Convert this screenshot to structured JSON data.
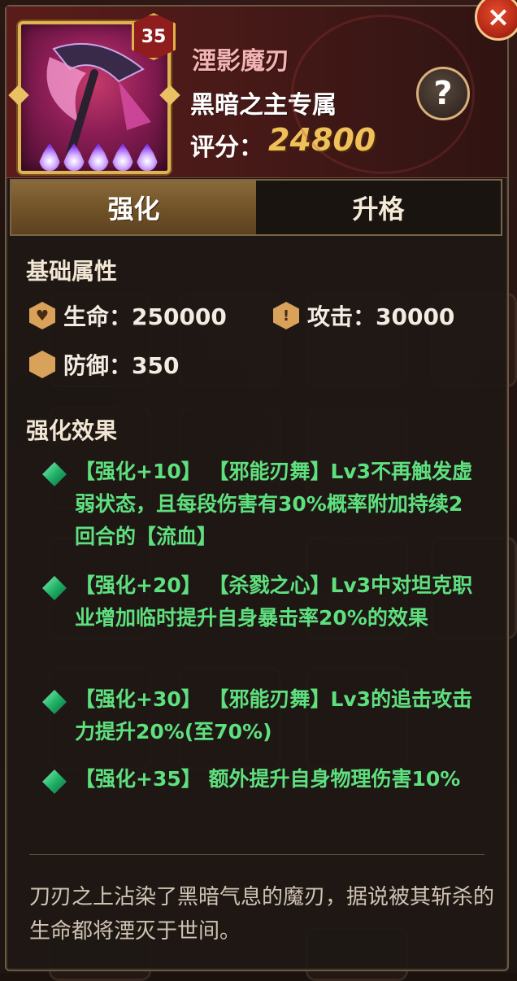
{
  "item": {
    "level": "35",
    "name": "湮影魔刃",
    "subtitle": "黑暗之主专属",
    "score_label": "评分：",
    "score_value": "24800",
    "star_flames": 5
  },
  "buttons": {
    "help": "?",
    "close": "×"
  },
  "tabs": [
    {
      "label": "强化",
      "active": true
    },
    {
      "label": "升格",
      "active": false
    }
  ],
  "base_attrs": {
    "title": "基础属性",
    "stats": [
      {
        "icon": "heart-icon",
        "label": "生命：250000"
      },
      {
        "icon": "sword-icon",
        "label": "攻击：30000"
      },
      {
        "icon": "shield-icon",
        "label": "防御：350"
      }
    ]
  },
  "effects": {
    "title": "强化效果",
    "items": [
      {
        "text": "【强化+10】  【邪能刃舞】Lv3不再触发虚弱状态，且每段伤害有30%概率附加持续2回合的【流血】"
      },
      {
        "text": "【强化+20】  【杀戮之心】Lv3中对坦克职业增加临时提升自身暴击率20%的效果"
      },
      {
        "text": "【强化+30】  【邪能刃舞】Lv3的追击攻击力提升20%(至70%)"
      },
      {
        "text": "【强化+35】 额外提升自身物理伤害10%"
      }
    ]
  },
  "description": "刀刃之上沾染了黑暗气息的魔刃，据说被其斩杀的生命都将湮灭于世间。",
  "colors": {
    "effect_text": "#5fe07f",
    "score": "#f0c05a",
    "tab_active": "#6e5026"
  }
}
